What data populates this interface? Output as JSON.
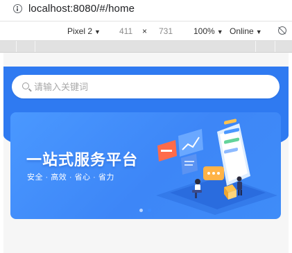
{
  "browser": {
    "url": "localhost:8080/#/home"
  },
  "devtools": {
    "device": "Pixel 2",
    "width": "411",
    "times": "×",
    "height": "731",
    "zoom": "100%",
    "network": "Online"
  },
  "search": {
    "placeholder": "请输入关键词"
  },
  "banner": {
    "title": "一站式服务平台",
    "subtitle": "安全 · 高效 · 省心 · 省力",
    "carousel_total": 2,
    "carousel_active": 2
  },
  "colors": {
    "brand": "#2f7af1",
    "banner_accent": "#ff6b4a",
    "dot_active": "#3d8bff",
    "dot_inactive": "#b7d4ff"
  }
}
